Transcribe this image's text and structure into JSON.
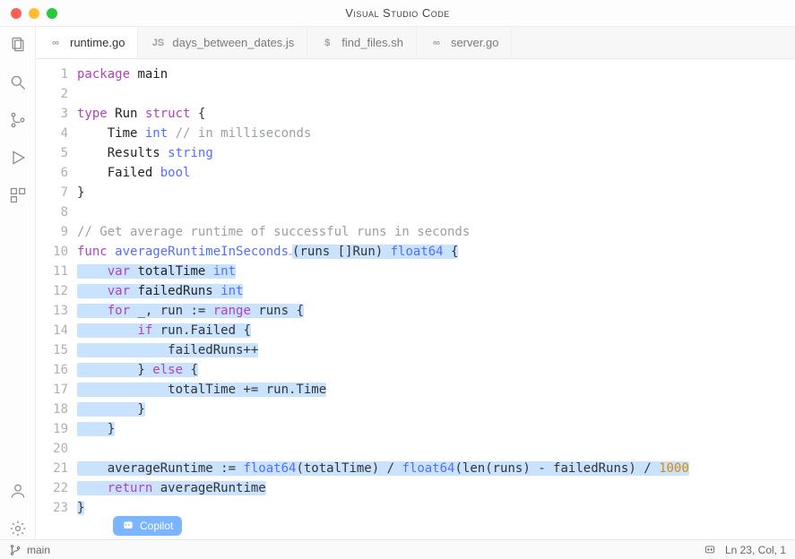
{
  "app_title": "Visual Studio Code",
  "tabs": [
    {
      "icon": "go",
      "label": "runtime.go",
      "active": true
    },
    {
      "icon": "js",
      "label": "days_between_dates.js",
      "active": false
    },
    {
      "icon": "sh",
      "label": "find_files.sh",
      "active": false
    },
    {
      "icon": "go",
      "label": "server.go",
      "active": false
    }
  ],
  "copilot_label": "Copilot",
  "statusbar": {
    "branch": "main",
    "cursor": "Ln 23, Col, 1"
  },
  "code_lines": [
    {
      "n": 1,
      "hl": false,
      "tokens": [
        [
          "pkb",
          "package"
        ],
        [
          "",
          " "
        ],
        [
          "id",
          "main"
        ]
      ]
    },
    {
      "n": 2,
      "hl": false,
      "tokens": []
    },
    {
      "n": 3,
      "hl": false,
      "tokens": [
        [
          "kw",
          "type"
        ],
        [
          "",
          " "
        ],
        [
          "id",
          "Run"
        ],
        [
          "",
          " "
        ],
        [
          "kw",
          "struct"
        ],
        [
          "",
          " "
        ],
        [
          "",
          "{"
        ]
      ]
    },
    {
      "n": 4,
      "hl": false,
      "tokens": [
        [
          "",
          "    "
        ],
        [
          "id",
          "Time"
        ],
        [
          "",
          " "
        ],
        [
          "ty",
          "int"
        ],
        [
          "",
          " "
        ],
        [
          "cm",
          "// in milliseconds"
        ]
      ]
    },
    {
      "n": 5,
      "hl": false,
      "tokens": [
        [
          "",
          "    "
        ],
        [
          "id",
          "Results"
        ],
        [
          "",
          " "
        ],
        [
          "ty",
          "string"
        ]
      ]
    },
    {
      "n": 6,
      "hl": false,
      "tokens": [
        [
          "",
          "    "
        ],
        [
          "id",
          "Failed"
        ],
        [
          "",
          " "
        ],
        [
          "ty",
          "bool"
        ]
      ]
    },
    {
      "n": 7,
      "hl": false,
      "tokens": [
        [
          "",
          "}"
        ]
      ]
    },
    {
      "n": 8,
      "hl": false,
      "tokens": []
    },
    {
      "n": 9,
      "hl": false,
      "tokens": [
        [
          "cm",
          "// Get average runtime of successful runs in seconds"
        ]
      ]
    },
    {
      "n": 10,
      "hl": true,
      "prefix": [
        [
          "kw",
          "func"
        ],
        [
          "",
          " "
        ],
        [
          "fn",
          "averageRuntimeInSeconds"
        ]
      ],
      "tokens": [
        [
          "",
          "(runs []Run) "
        ],
        [
          "ty",
          "float64"
        ],
        [
          "",
          " {"
        ]
      ]
    },
    {
      "n": 11,
      "hl": true,
      "tokens": [
        [
          "",
          "    "
        ],
        [
          "kw",
          "var"
        ],
        [
          "",
          " "
        ],
        [
          "id",
          "totalTime"
        ],
        [
          "",
          " "
        ],
        [
          "ty",
          "int"
        ]
      ]
    },
    {
      "n": 12,
      "hl": true,
      "tokens": [
        [
          "",
          "    "
        ],
        [
          "kw",
          "var"
        ],
        [
          "",
          " "
        ],
        [
          "id",
          "failedRuns"
        ],
        [
          "",
          " "
        ],
        [
          "ty",
          "int"
        ]
      ]
    },
    {
      "n": 13,
      "hl": true,
      "tokens": [
        [
          "",
          "    "
        ],
        [
          "kw",
          "for"
        ],
        [
          "",
          " _, run := "
        ],
        [
          "kw",
          "range"
        ],
        [
          "",
          " runs {"
        ]
      ]
    },
    {
      "n": 14,
      "hl": true,
      "tokens": [
        [
          "",
          "        "
        ],
        [
          "kw",
          "if"
        ],
        [
          "",
          " run.Failed {"
        ]
      ]
    },
    {
      "n": 15,
      "hl": true,
      "tokens": [
        [
          "",
          "            failedRuns++"
        ]
      ]
    },
    {
      "n": 16,
      "hl": true,
      "tokens": [
        [
          "",
          "        } "
        ],
        [
          "kw",
          "else"
        ],
        [
          "",
          " {"
        ]
      ]
    },
    {
      "n": 17,
      "hl": true,
      "tokens": [
        [
          "",
          "            totalTime += run.Time"
        ]
      ]
    },
    {
      "n": 18,
      "hl": true,
      "tokens": [
        [
          "",
          "        }"
        ]
      ]
    },
    {
      "n": 19,
      "hl": true,
      "tokens": [
        [
          "",
          "    }"
        ]
      ]
    },
    {
      "n": 20,
      "hl": false,
      "tokens": []
    },
    {
      "n": 21,
      "hl": true,
      "tokens": [
        [
          "",
          "    averageRuntime := "
        ],
        [
          "ty",
          "float64"
        ],
        [
          "",
          "(totalTime) / "
        ],
        [
          "ty",
          "float64"
        ],
        [
          "",
          "(len(runs) - failedRuns) / "
        ],
        [
          "num",
          "1000"
        ]
      ]
    },
    {
      "n": 22,
      "hl": true,
      "tokens": [
        [
          "",
          "    "
        ],
        [
          "kw",
          "return"
        ],
        [
          "",
          " averageRuntime"
        ]
      ]
    },
    {
      "n": 23,
      "hl": true,
      "tokens": [
        [
          "",
          "}"
        ]
      ],
      "cursor": true
    }
  ]
}
